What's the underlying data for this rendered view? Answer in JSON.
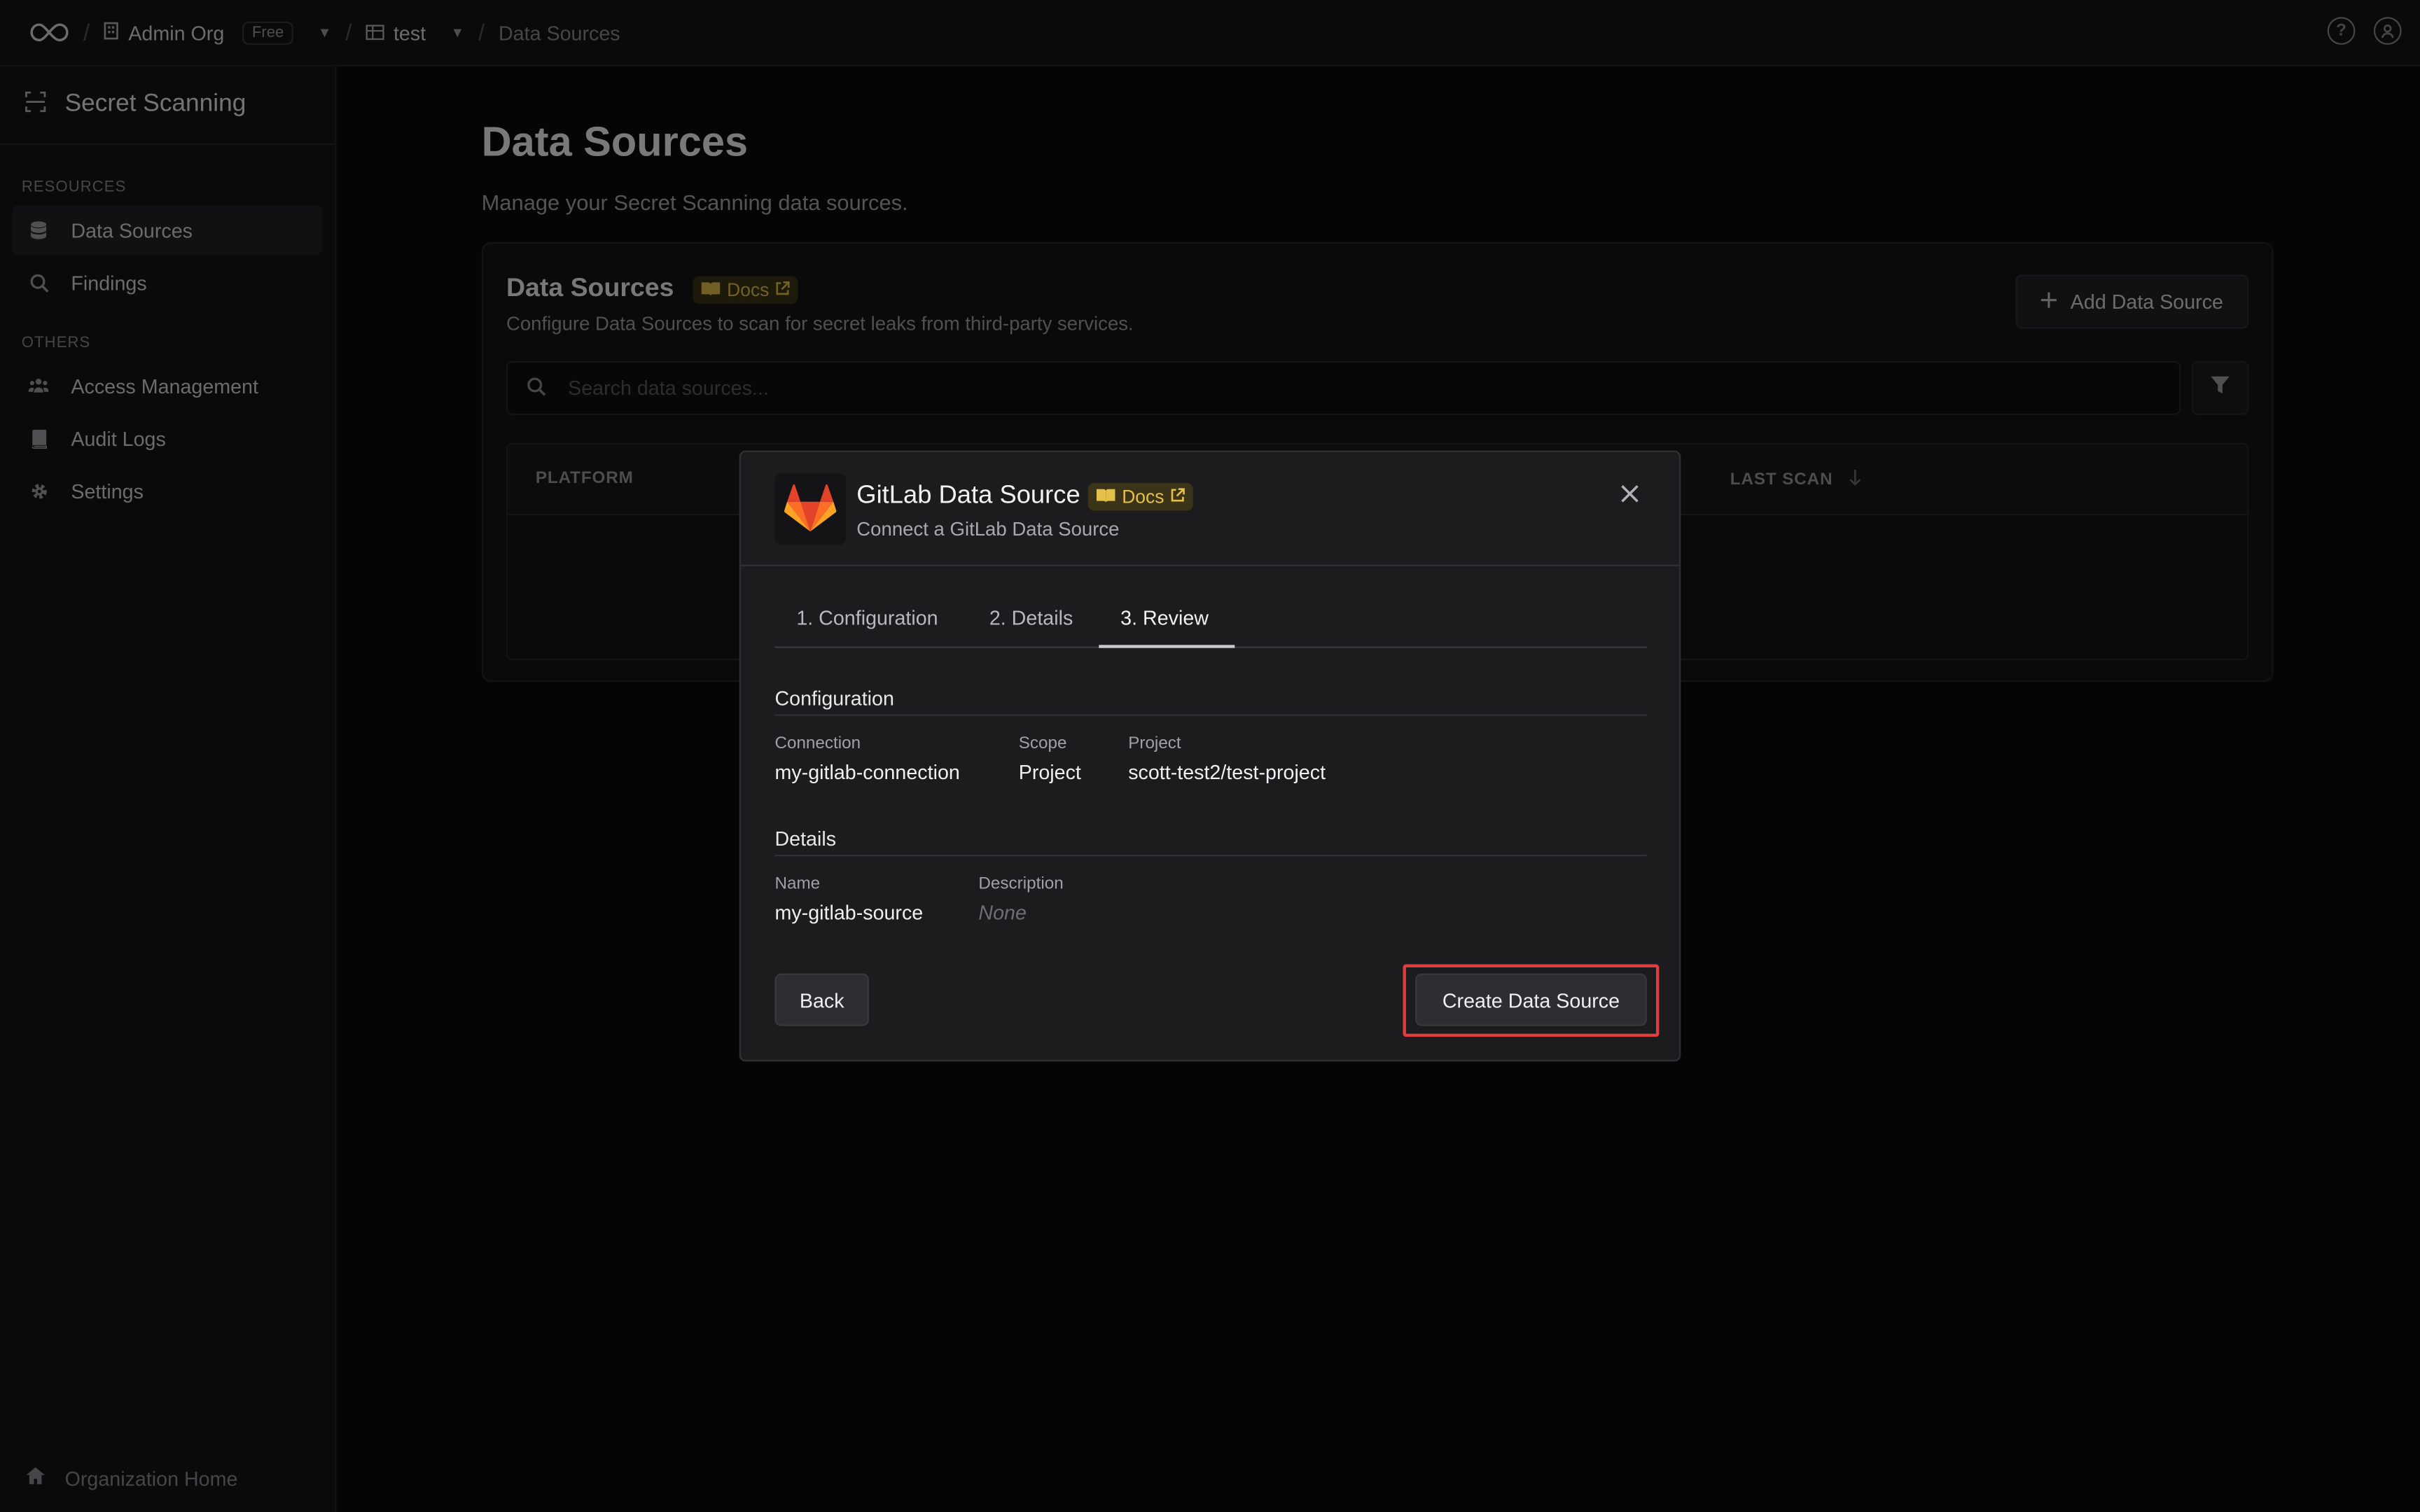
{
  "topbar": {
    "org_name": "Admin Org",
    "plan_badge": "Free",
    "project_name": "test",
    "current_page": "Data Sources"
  },
  "sidebar": {
    "product_name": "Secret Scanning",
    "sections": [
      {
        "label": "RESOURCES",
        "items": [
          {
            "label": "Data Sources",
            "icon": "database-icon",
            "active": true
          },
          {
            "label": "Findings",
            "icon": "search-icon",
            "active": false
          }
        ]
      },
      {
        "label": "OTHERS",
        "items": [
          {
            "label": "Access Management",
            "icon": "users-icon",
            "active": false
          },
          {
            "label": "Audit Logs",
            "icon": "book-icon",
            "active": false
          },
          {
            "label": "Settings",
            "icon": "gear-icon",
            "active": false
          }
        ]
      }
    ],
    "footer_label": "Organization Home"
  },
  "main": {
    "title": "Data Sources",
    "subtitle": "Manage your Secret Scanning data sources.",
    "panel": {
      "title": "Data Sources",
      "docs_label": "Docs",
      "description": "Configure Data Sources to scan for secret leaks from third-party services.",
      "add_button": "Add Data Source",
      "search_placeholder": "Search data sources...",
      "columns": [
        "PLATFORM",
        "LAST SCAN"
      ]
    }
  },
  "modal": {
    "title": "GitLab Data Source",
    "docs_label": "Docs",
    "subtitle": "Connect a GitLab Data Source",
    "tabs": [
      {
        "label": "1. Configuration",
        "active": false
      },
      {
        "label": "2. Details",
        "active": false
      },
      {
        "label": "3. Review",
        "active": true
      }
    ],
    "configuration": {
      "heading": "Configuration",
      "connection_label": "Connection",
      "connection_value": "my-gitlab-connection",
      "scope_label": "Scope",
      "scope_value": "Project",
      "project_label": "Project",
      "project_value": "scott-test2/test-project"
    },
    "details": {
      "heading": "Details",
      "name_label": "Name",
      "name_value": "my-gitlab-source",
      "description_label": "Description",
      "description_value": "None"
    },
    "back_button": "Back",
    "create_button": "Create Data Source"
  },
  "colors": {
    "accent_docs": "#e3c04a",
    "highlight_outline": "#e23d3d",
    "gitlab_orange": "#e24329"
  }
}
